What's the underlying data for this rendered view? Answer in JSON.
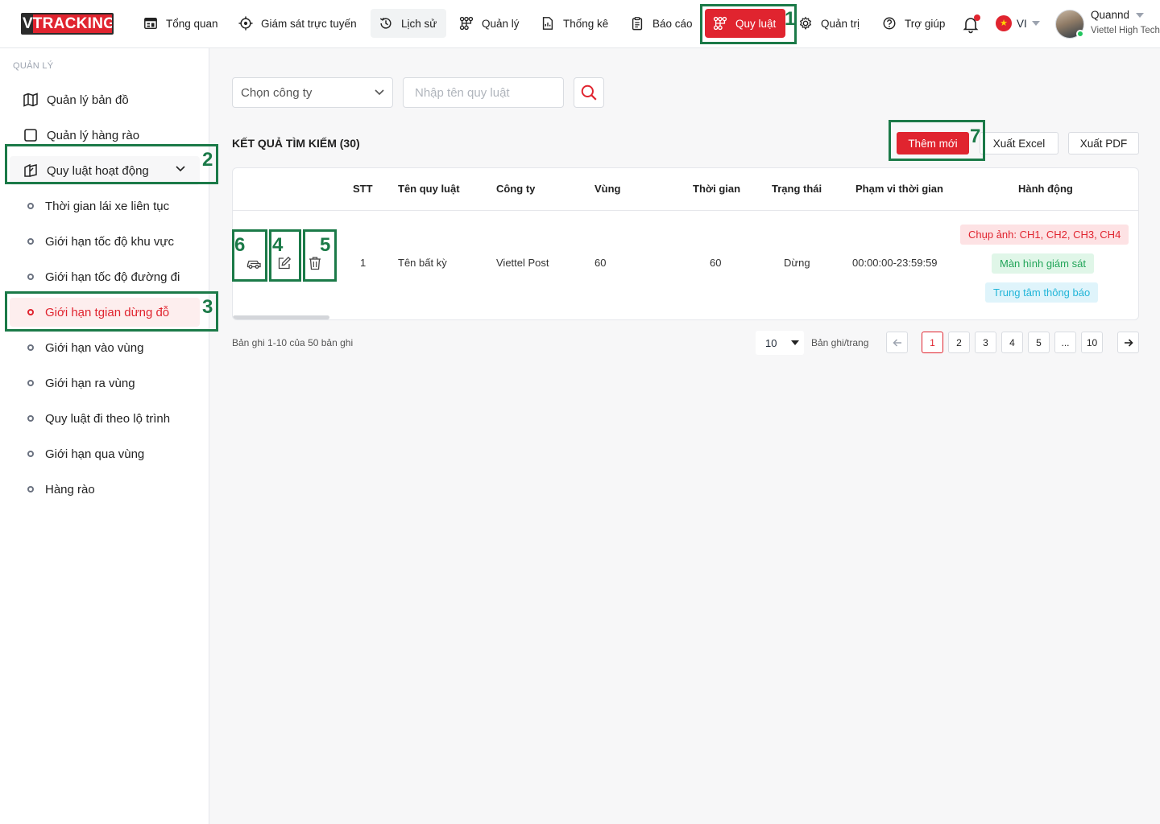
{
  "brand": {
    "logo_v": "V",
    "logo_text": "TRACKING"
  },
  "nav": [
    {
      "label": "Tổng quan",
      "icon": "dashboard-icon"
    },
    {
      "label": "Giám sát trực tuyến",
      "icon": "crosshair-icon"
    },
    {
      "label": "Lịch sử",
      "icon": "history-icon"
    },
    {
      "label": "Quản lý",
      "icon": "nodes-icon"
    },
    {
      "label": "Thống kê",
      "icon": "report-file-icon"
    },
    {
      "label": "Báo cáo",
      "icon": "clipboard-icon"
    },
    {
      "label": "Quy luật",
      "icon": "rules-icon",
      "active": true
    },
    {
      "label": "Quản trị",
      "icon": "gear-icon"
    },
    {
      "label": "Trợ giúp",
      "icon": "help-icon"
    }
  ],
  "user": {
    "lang": "VI",
    "name": "Quannd",
    "company": "Viettel High Tech"
  },
  "sidebar": {
    "title": "QUẢN LÝ",
    "items": [
      {
        "label": "Quản lý bản đồ",
        "icon": "map-icon"
      },
      {
        "label": "Quản lý hàng rào",
        "icon": "square-icon"
      },
      {
        "label": "Quy luật hoạt động",
        "icon": "rules-book-icon",
        "expanded": true
      }
    ],
    "sub_items": [
      {
        "label": "Thời gian lái xe liên tục"
      },
      {
        "label": "Giới hạn tốc độ khu vực"
      },
      {
        "label": "Giới hạn tốc độ đường đi"
      },
      {
        "label": "Giới hạn tgian dừng đỗ",
        "active": true
      },
      {
        "label": "Giới hạn vào vùng"
      },
      {
        "label": "Giới hạn ra vùng"
      },
      {
        "label": "Quy luật đi theo lộ trình"
      },
      {
        "label": "Giới hạn qua vùng"
      },
      {
        "label": "Hàng rào"
      }
    ]
  },
  "filters": {
    "company_placeholder": "Chọn công ty",
    "rule_placeholder": "Nhập tên quy luật"
  },
  "results": {
    "title": "KẾT QUẢ TÌM KIẾM (30)",
    "add_label": "Thêm mới",
    "excel_label": "Xuất Excel",
    "pdf_label": "Xuất PDF"
  },
  "table": {
    "columns": [
      "STT",
      "Tên quy luật",
      "Công ty",
      "Vùng",
      "Thời gian",
      "Trạng thái",
      "Phạm vi thời gian",
      "Hành động"
    ],
    "rows": [
      {
        "stt": "1",
        "name": "Tên bất kỳ",
        "company": "Viettel Post",
        "zone": "60",
        "time": "60",
        "status": "Dừng",
        "range": "00:00:00-23:59:59",
        "actions": [
          "Chụp ảnh: CH1, CH2, CH3, CH4",
          "Màn hình giám sát",
          "Trung tâm thông báo"
        ]
      }
    ]
  },
  "pagination": {
    "info": "Bản ghi 1-10 của 50 bản ghi",
    "per_page": "10",
    "per_page_label": "Bản ghi/trang",
    "pages": [
      "1",
      "2",
      "3",
      "4",
      "5",
      "...",
      "10"
    ],
    "current": "1"
  },
  "annotations": [
    "1",
    "2",
    "3",
    "4",
    "5",
    "6",
    "7"
  ]
}
